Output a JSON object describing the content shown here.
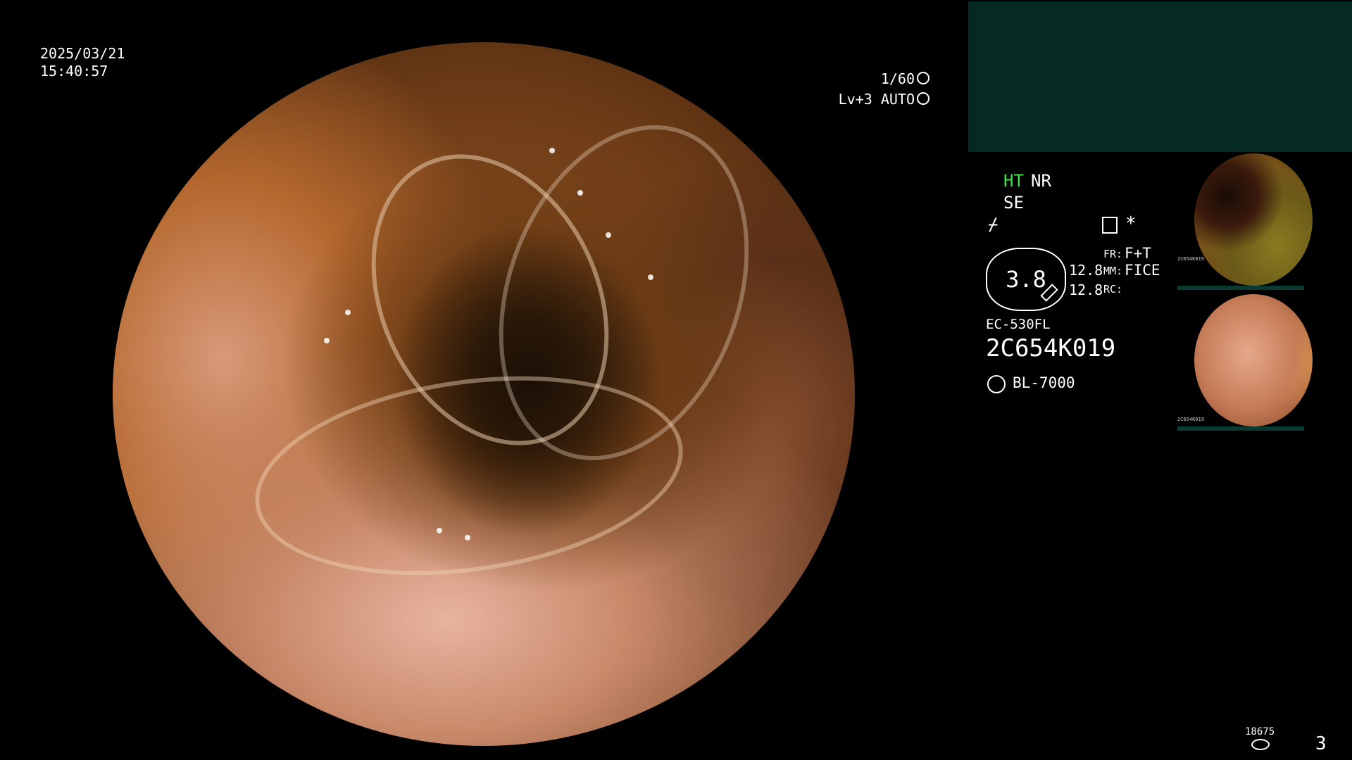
{
  "overlay": {
    "date": "2025/03/21",
    "time": "15:40:57",
    "shutter": "1/60",
    "level": "Lv+3 AUTO"
  },
  "settings": {
    "ht": "HT",
    "nr": "NR",
    "se": "SE",
    "zoom_value": "3.8",
    "value_top": "12.8",
    "value_bottom": "12.8",
    "fr_label": "FR:",
    "fr_value": "F+T",
    "mm_label": "MM:",
    "mm_value": "FICE",
    "rc_label": "RC:",
    "star": "*",
    "scope_model": "EC-530FL",
    "serial": "2C654K019",
    "light_source": "BL-7000",
    "ht_color": "#3fe34b"
  },
  "thumbnails": [
    {
      "label": "2C654K019"
    },
    {
      "label": "2C654K019"
    }
  ],
  "footer": {
    "count": "18675",
    "page": "3"
  }
}
